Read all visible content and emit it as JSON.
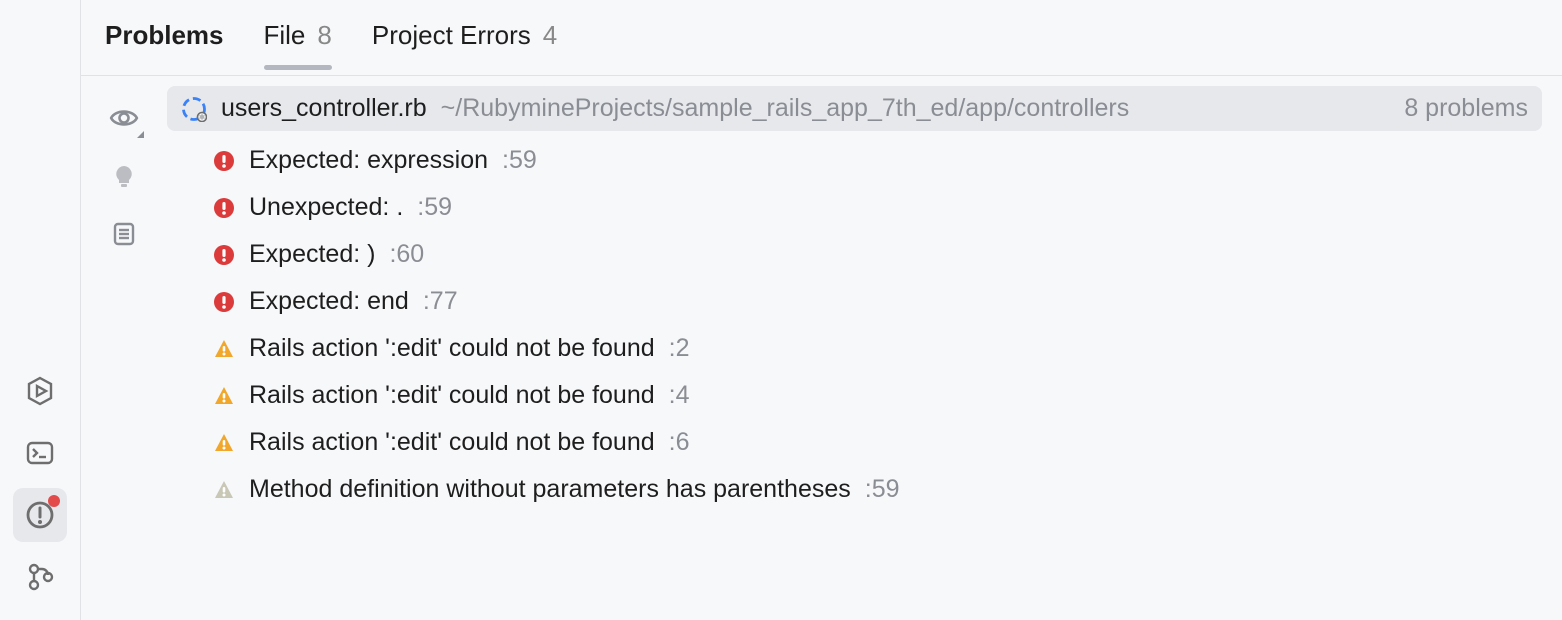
{
  "tabs": {
    "problems_label": "Problems",
    "file_label": "File",
    "file_count": "8",
    "project_errors_label": "Project Errors",
    "project_errors_count": "4"
  },
  "file": {
    "name": "users_controller.rb",
    "path": "~/RubymineProjects/sample_rails_app_7th_ed/app/controllers",
    "problem_count_text": "8 problems"
  },
  "issues": [
    {
      "severity": "error",
      "text": "Expected: expression",
      "loc": ":59"
    },
    {
      "severity": "error",
      "text": "Unexpected: .",
      "loc": ":59"
    },
    {
      "severity": "error",
      "text": "Expected: )",
      "loc": ":60"
    },
    {
      "severity": "error",
      "text": "Expected: end",
      "loc": ":77"
    },
    {
      "severity": "warning",
      "text": "Rails action ':edit' could not be found",
      "loc": ":2"
    },
    {
      "severity": "warning",
      "text": "Rails action ':edit' could not be found",
      "loc": ":4"
    },
    {
      "severity": "warning",
      "text": "Rails action ':edit' could not be found",
      "loc": ":6"
    },
    {
      "severity": "weak",
      "text": "Method definition without parameters has parentheses",
      "loc": ":59"
    }
  ]
}
